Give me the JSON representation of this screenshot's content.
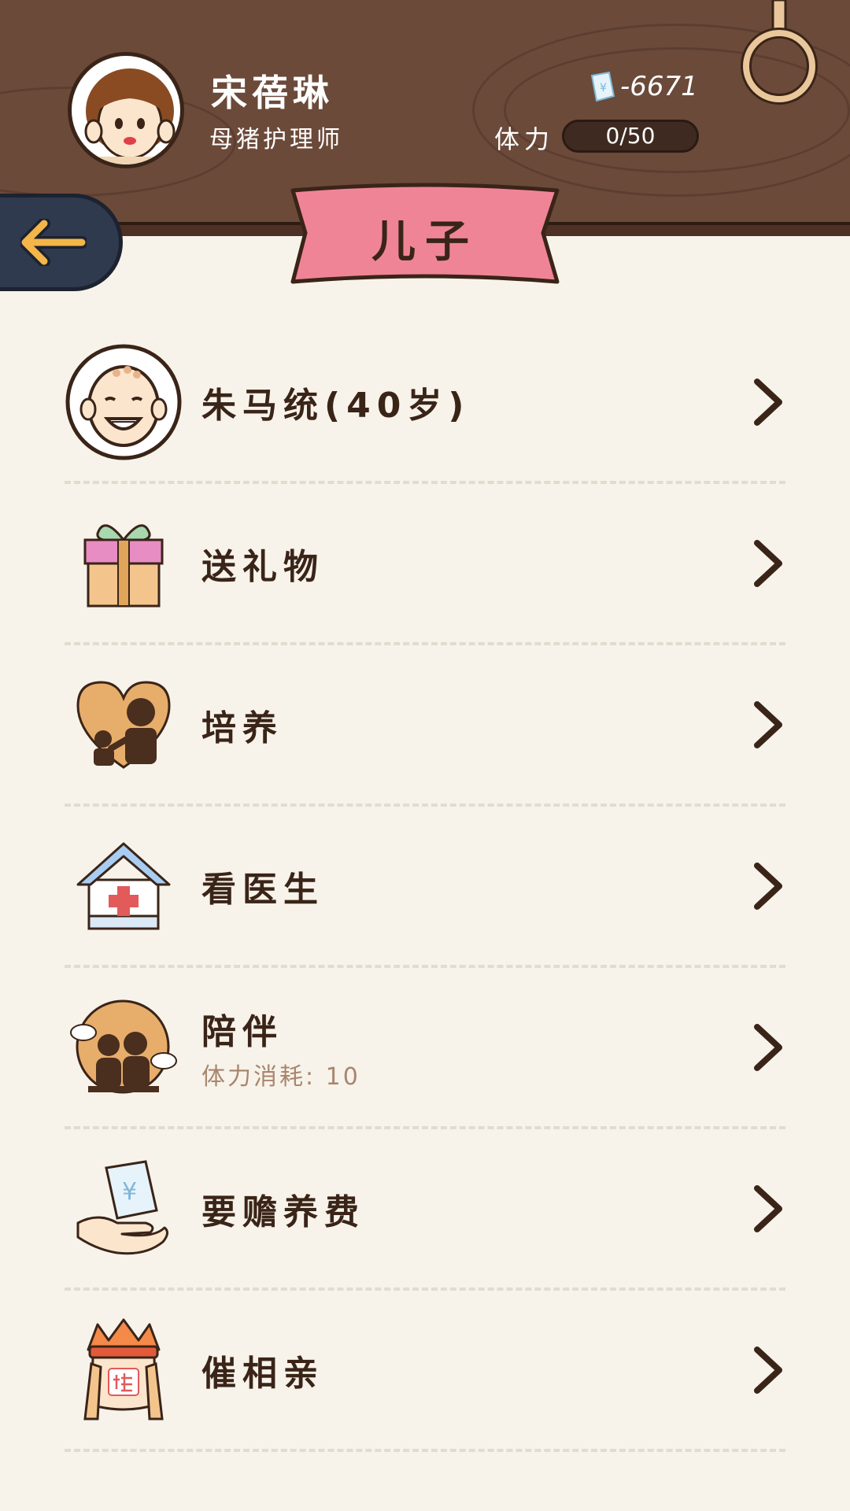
{
  "profile": {
    "name": "宋蓓琳",
    "title": "母猪护理师",
    "money": "-6671",
    "stamina_label": "体力",
    "stamina_text": "0/50",
    "stamina_fraction": 0
  },
  "page": {
    "title": "儿子"
  },
  "menu": [
    {
      "label": "朱马统(40岁)",
      "icon": "son-avatar-icon"
    },
    {
      "label": "送礼物",
      "icon": "gift-icon"
    },
    {
      "label": "培养",
      "icon": "nurture-heart-icon"
    },
    {
      "label": "看医生",
      "icon": "hospital-icon"
    },
    {
      "label": "陪伴",
      "sub": "体力消耗: 10",
      "icon": "companion-icon"
    },
    {
      "label": "要赡养费",
      "icon": "money-hand-icon"
    },
    {
      "label": "催相亲",
      "icon": "matchmaking-icon"
    }
  ],
  "colors": {
    "wood": "#6b4a3a",
    "background": "#f7f3ea",
    "banner": "#f08497",
    "back_button": "#2f3a4e",
    "arrow": "#f4b549"
  }
}
